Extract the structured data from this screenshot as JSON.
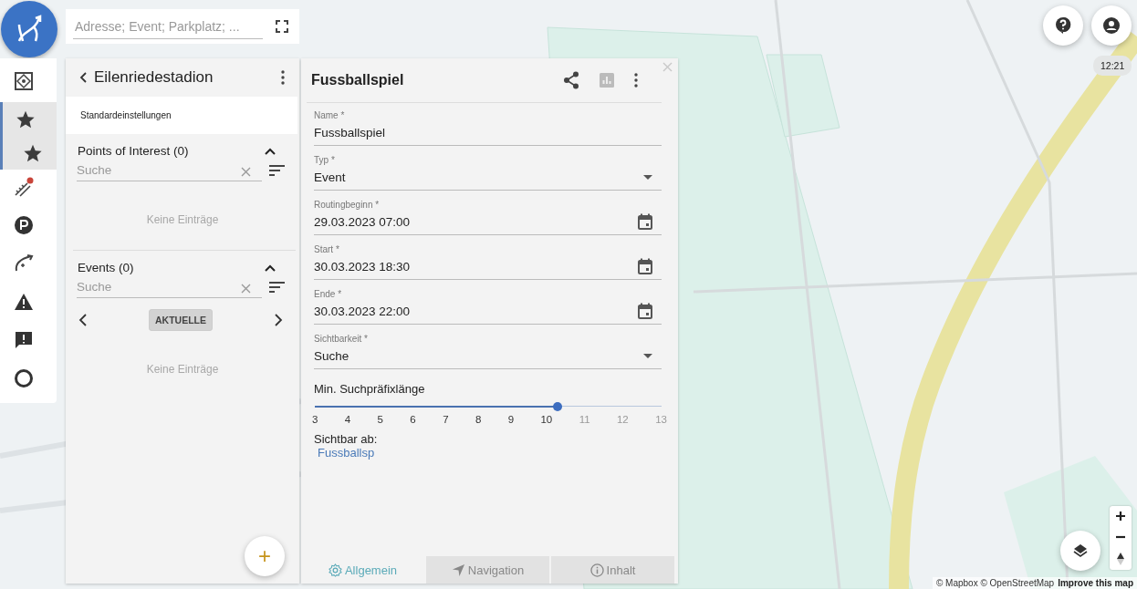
{
  "search": {
    "placeholder": "Adresse; Event; Parkplatz; ..."
  },
  "rail": [
    {
      "kind": "map",
      "selected": false
    },
    {
      "kind": "star",
      "selected": true
    },
    {
      "kind": "star-sub",
      "selected": true
    },
    {
      "kind": "wand",
      "selected": false
    },
    {
      "kind": "parking",
      "selected": false
    },
    {
      "kind": "route",
      "selected": false
    },
    {
      "kind": "warning",
      "selected": false
    },
    {
      "kind": "feedback",
      "selected": false
    },
    {
      "kind": "circle",
      "selected": false
    }
  ],
  "list_panel": {
    "title": "Eilenriedestadion",
    "subtitle": "Standardeinstellungen",
    "sections": [
      {
        "title": "Points of Interest (0)",
        "expanded": true,
        "search_placeholder": "Suche",
        "empty": "Keine Einträge"
      },
      {
        "title": "Events (0)",
        "expanded": true,
        "search_placeholder": "Suche",
        "filter_chip": "AKTUELLE",
        "empty": "Keine Einträge"
      }
    ],
    "fab": "+"
  },
  "detail_panel": {
    "title": "Fussballspiel",
    "fields": [
      {
        "kind": "text",
        "label": "Name *",
        "value": "Fussballspiel"
      },
      {
        "kind": "select",
        "label": "Typ *",
        "value": "Event"
      },
      {
        "kind": "date",
        "label": "Routingbeginn *",
        "value": "29.03.2023 07:00"
      },
      {
        "kind": "date",
        "label": "Start *",
        "value": "30.03.2023 18:30"
      },
      {
        "kind": "date",
        "label": "Ende *",
        "value": "30.03.2023 22:00"
      },
      {
        "kind": "select",
        "label": "Sichtbarkeit *",
        "value": "Suche"
      }
    ],
    "slider": {
      "label": "Min. Suchpräfixlänge",
      "level": 0.7,
      "ticks": [
        "3",
        "4",
        "5",
        "6",
        "7",
        "8",
        "9",
        "10",
        "11",
        "12",
        "13"
      ]
    },
    "visible_from": {
      "label": "Sichtbar ab:",
      "value": "Fussballsp"
    },
    "tabs": [
      {
        "kind": "gear",
        "label": "Allgemein",
        "selected": true
      },
      {
        "kind": "navigation",
        "label": "Navigation",
        "selected": false
      },
      {
        "kind": "info",
        "label": "Inhalt",
        "selected": false
      }
    ]
  },
  "time": "12:21",
  "attribution": {
    "text": "© Mapbox © OpenStreetMap",
    "link": "Improve this map"
  }
}
